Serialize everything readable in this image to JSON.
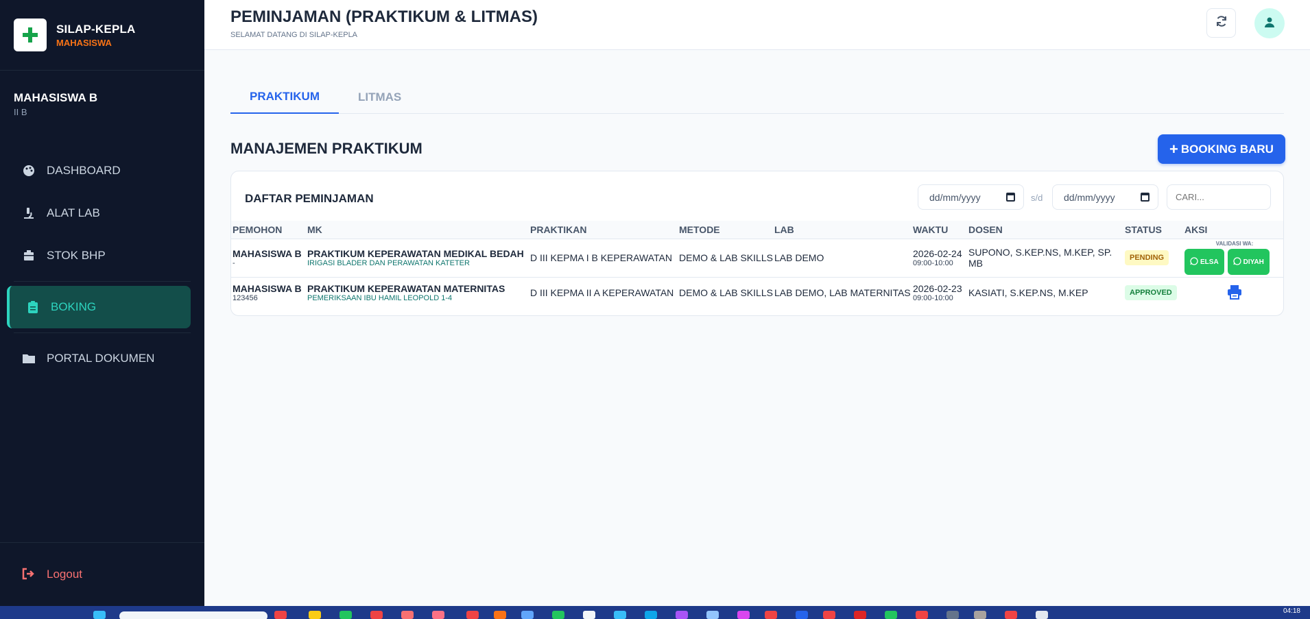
{
  "brand": {
    "title": "SILAP-KEPLA",
    "role": "MAHASISWA"
  },
  "user": {
    "name": "MAHASISWA B",
    "class": "II B"
  },
  "nav": [
    {
      "label": "DASHBOARD",
      "icon": "palette-icon"
    },
    {
      "label": "ALAT LAB",
      "icon": "microscope-icon"
    },
    {
      "label": "STOK BHP",
      "icon": "box-icon"
    },
    {
      "label": "BOKING",
      "icon": "clipboard-icon",
      "active": true
    },
    {
      "label": "PORTAL DOKUMEN",
      "icon": "folder-icon"
    }
  ],
  "logout": "Logout",
  "header": {
    "title": "PEMINJAMAN (PRAKTIKUM & LITMAS)",
    "subtitle": "SELAMAT DATANG DI SILAP-KEPLA"
  },
  "tabs": [
    "PRAKTIKUM",
    "LITMAS"
  ],
  "section_title": "MANAJEMEN PRAKTIKUM",
  "new_button": "BOOKING BARU",
  "list": {
    "title": "DAFTAR PEMINJAMAN",
    "date_from_placeholder": "dd/mm/yyyy",
    "date_to_placeholder": "dd/mm/yyyy",
    "range_sep": "s/d",
    "search_placeholder": "CARI...",
    "columns": [
      "PEMOHON",
      "MK",
      "PRAKTIKAN",
      "METODE",
      "LAB",
      "WAKTU",
      "DOSEN",
      "STATUS",
      "AKSI"
    ],
    "validasi_label": "VALIDASI WA:",
    "rows": [
      {
        "pemohon": "MAHASISWA B",
        "pemohon_sub": "-",
        "mk": "PRAKTIKUM KEPERAWATAN MEDIKAL BEDAH",
        "mk_sub": "IRIGASI BLADER DAN PERAWATAN KATETER",
        "praktikan": "D III KEPMA I B KEPERAWATAN",
        "metode": "DEMO & LAB SKILLS",
        "lab": "LAB DEMO",
        "tanggal": "2026-02-24",
        "jam": "09:00-10:00",
        "dosen": "SUPONO, S.KEP.NS, M.KEP, SP. MB",
        "status": "PENDING",
        "wa_buttons": [
          "ELSA",
          "DIYAH"
        ]
      },
      {
        "pemohon": "MAHASISWA B",
        "pemohon_sub": "123456",
        "mk": "PRAKTIKUM KEPERAWATAN MATERNITAS",
        "mk_sub": "PEMERIKSAAN IBU HAMIL LEOPOLD 1-4",
        "praktikan": "D III KEPMA II A KEPERAWATAN",
        "metode": "DEMO & LAB SKILLS",
        "lab": "LAB DEMO, LAB MATERNITAS",
        "tanggal": "2026-02-23",
        "jam": "09:00-10:00",
        "dosen": "KASIATI, S.KEP.NS, M.KEP",
        "status": "APPROVED",
        "action_icon": "printer-icon"
      }
    ]
  },
  "taskbar": {
    "clock": "04:18"
  }
}
